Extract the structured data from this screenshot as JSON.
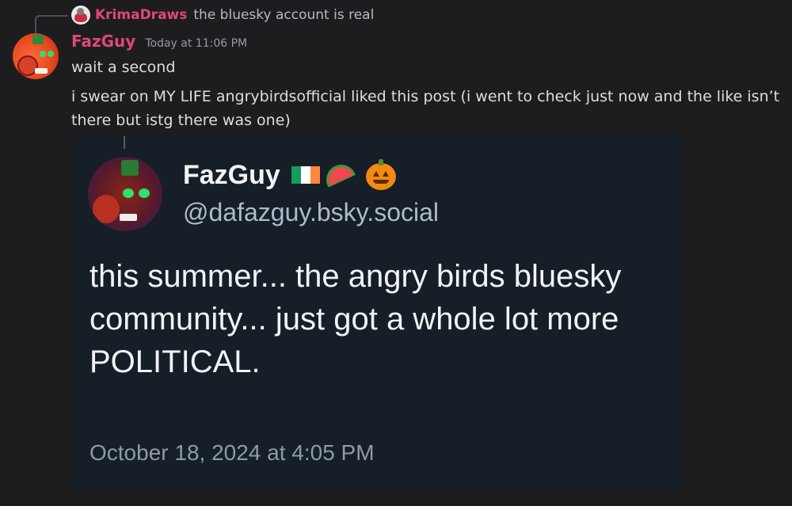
{
  "reply": {
    "author": "KrimaDraws",
    "text": "the bluesky account is real"
  },
  "message": {
    "author": "FazGuy",
    "timestamp": "Today at 11:06 PM",
    "lines": [
      "wait a second",
      "i swear on MY LIFE angrybirdsofficial liked this post (i went to check just now and the like isn’t there but istg there was one)"
    ],
    "author_color": "#e0477a"
  },
  "embed": {
    "display_name": "FazGuy",
    "handle": "@dafazguy.bsky.social",
    "post_text": "this summer... the angry birds bluesky community... just got a whole lot more POLITICAL.",
    "date": "October 18, 2024 at 4:05 PM",
    "name_emojis": [
      "ireland-flag",
      "watermelon",
      "jack-o-lantern"
    ],
    "background_color": "#161e27"
  }
}
